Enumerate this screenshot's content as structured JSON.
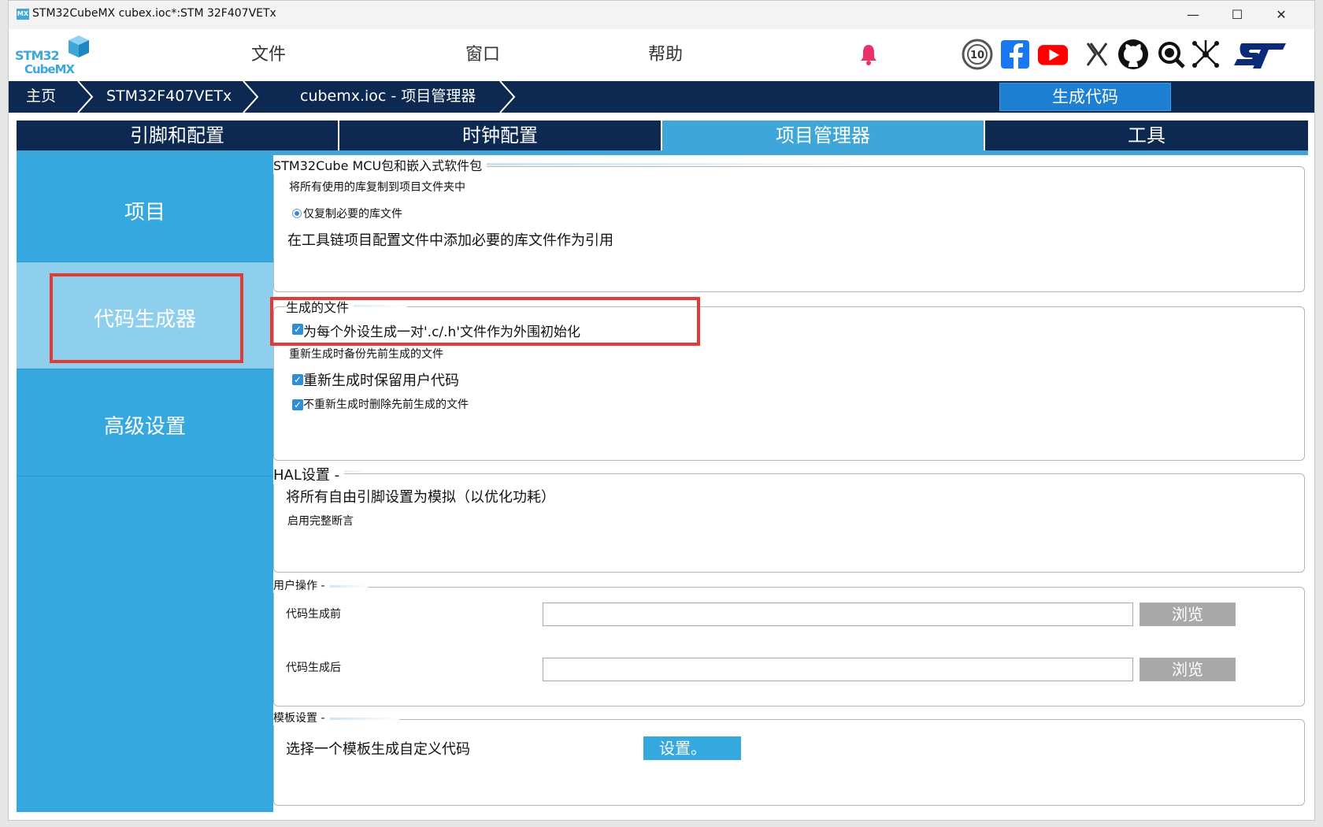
{
  "window": {
    "title": "STM32CubeMX cubex.ioc*:STM 32F407VETx",
    "icon_text": "MX",
    "min": "—",
    "max": "☐",
    "close": "✕"
  },
  "logo": {
    "line1": "STM32",
    "line2": "CubeMX"
  },
  "menu": {
    "file": "文件",
    "window": "窗口",
    "help": "帮助"
  },
  "breadcrumb": {
    "home": "主页",
    "mcu": "STM32F407VETx",
    "project": "cubemx.ioc - 项目管理器"
  },
  "generate_button": "生成代码",
  "tabs": [
    "引脚和配置",
    "时钟配置",
    "项目管理器",
    "工具"
  ],
  "sidebar": [
    "项目",
    "代码生成器",
    "高级设置"
  ],
  "groups": {
    "mcu_pkg": {
      "title": "STM32Cube MCU包和嵌入式软件包",
      "opt_copy_all": "将所有使用的库复制到项目文件夹中",
      "opt_copy_needed": "仅复制必要的库文件",
      "opt_reference": "在工具链项目配置文件中添加必要的库文件作为引用"
    },
    "gen_files": {
      "title": "生成的文件",
      "opt_pair": "为每个外设生成一对'.c/.h'文件作为外围初始化",
      "opt_backup": "重新生成时备份先前生成的文件",
      "opt_keep": "重新生成时保留用户代码",
      "opt_delete": "不重新生成时删除先前生成的文件"
    },
    "hal": {
      "title": "HAL设置 -",
      "opt_analog": "将所有自由引脚设置为模拟（以优化功耗）",
      "opt_assert": "启用完整断言"
    },
    "user_actions": {
      "title": "用户操作 -",
      "before": "代码生成前",
      "after": "代码生成后",
      "browse": "浏览"
    },
    "template": {
      "title": "模板设置 -",
      "label": "选择一个模板生成自定义代码",
      "button": "设置。"
    }
  },
  "colors": {
    "navy": "#0d2851",
    "accent": "#35a8e0",
    "highlight": "#e53935"
  }
}
